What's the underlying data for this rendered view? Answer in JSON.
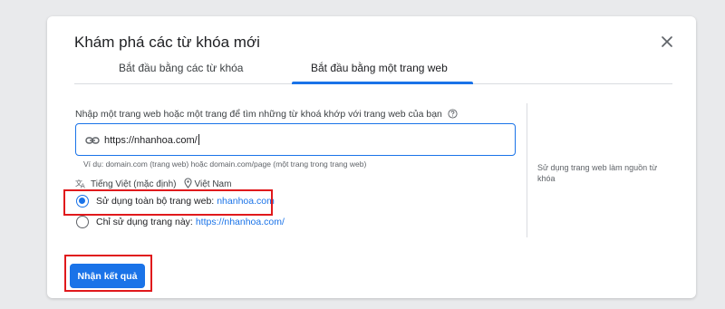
{
  "dialog": {
    "title": "Khám phá các từ khóa mới",
    "close_icon": "close-icon"
  },
  "tabs": [
    {
      "label": "Bắt đầu bằng các từ khóa",
      "active": false
    },
    {
      "label": "Bắt đầu bằng một trang web",
      "active": true
    }
  ],
  "form": {
    "prompt": "Nhập một trang web hoặc một trang để tìm những từ khoá khớp với trang web của bạn",
    "url_value": "https://nhanhoa.com/",
    "hint": "Ví dụ: domain.com (trang web) hoặc domain.com/page (một trang trong trang web)",
    "language": "Tiếng Việt (mặc định)",
    "location": "Việt Nam",
    "options": [
      {
        "label": "Sử dụng toàn bộ trang web:",
        "link": "nhanhoa.com",
        "checked": true
      },
      {
        "label": "Chỉ sử dụng trang này:",
        "link": "https://nhanhoa.com/",
        "checked": false
      }
    ]
  },
  "side_note": "Sử dụng trang web làm nguồn từ khóa",
  "submit_label": "Nhận kết quả",
  "colors": {
    "accent": "#1a73e8",
    "highlight": "#e0191c",
    "background": "#e9eaec"
  }
}
